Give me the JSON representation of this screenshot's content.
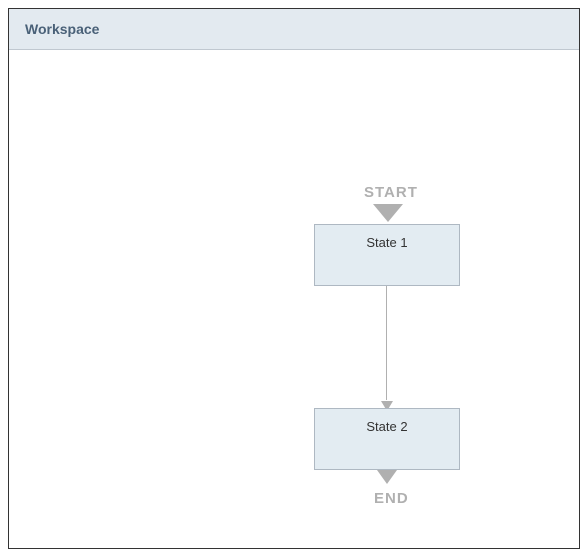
{
  "header": {
    "title": "Workspace"
  },
  "flow": {
    "start_label": "START",
    "end_label": "END",
    "states": [
      {
        "label": "State 1"
      },
      {
        "label": "State 2"
      }
    ]
  }
}
